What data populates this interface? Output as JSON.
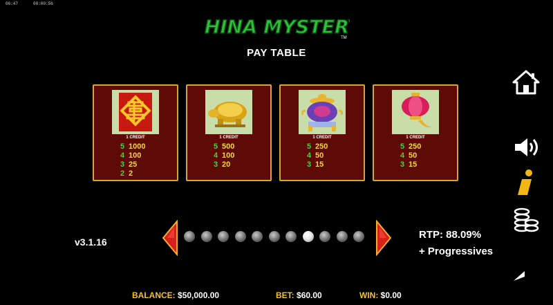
{
  "status": {
    "clock_left": "06:47",
    "clock_right": "00:00:56"
  },
  "logo": {
    "text": "CHINA MYSTERY",
    "mark": "TM"
  },
  "title": "PAY TABLE",
  "cards": [
    {
      "symbol": "fortune-emblem",
      "credit": "1 CREDIT",
      "pays": [
        {
          "count": "5",
          "amount": "1000"
        },
        {
          "count": "4",
          "amount": "100"
        },
        {
          "count": "3",
          "amount": "25"
        },
        {
          "count": "2",
          "amount": "2"
        }
      ]
    },
    {
      "symbol": "golden-turtle",
      "credit": "1 CREDIT",
      "pays": [
        {
          "count": "5",
          "amount": "500"
        },
        {
          "count": "4",
          "amount": "100"
        },
        {
          "count": "3",
          "amount": "20"
        }
      ]
    },
    {
      "symbol": "purple-urn",
      "credit": "1 CREDIT",
      "pays": [
        {
          "count": "5",
          "amount": "250"
        },
        {
          "count": "4",
          "amount": "50"
        },
        {
          "count": "3",
          "amount": "15"
        }
      ]
    },
    {
      "symbol": "red-lantern",
      "credit": "1 CREDIT",
      "pays": [
        {
          "count": "5",
          "amount": "250"
        },
        {
          "count": "4",
          "amount": "50"
        },
        {
          "count": "3",
          "amount": "15"
        }
      ]
    }
  ],
  "pagination": {
    "total": 11,
    "current": 8
  },
  "version": "v3.1.16",
  "rtp": {
    "line1": "RTP: 88.09%",
    "line2": "+ Progressives"
  },
  "footer": {
    "balance_label": "BALANCE:",
    "balance_value": "$50,000.00",
    "bet_label": "BET:",
    "bet_value": "$60.00",
    "win_label": "WIN:",
    "win_value": "$0.00"
  },
  "colors": {
    "accent_gold": "#f2c12e",
    "pay_green": "#49d53a",
    "card_bg": "#5e0a06",
    "logo_green": "#2fbf3a"
  },
  "icons": [
    "home-icon",
    "sound-icon",
    "info-icon",
    "coins-icon",
    "back-icon"
  ]
}
